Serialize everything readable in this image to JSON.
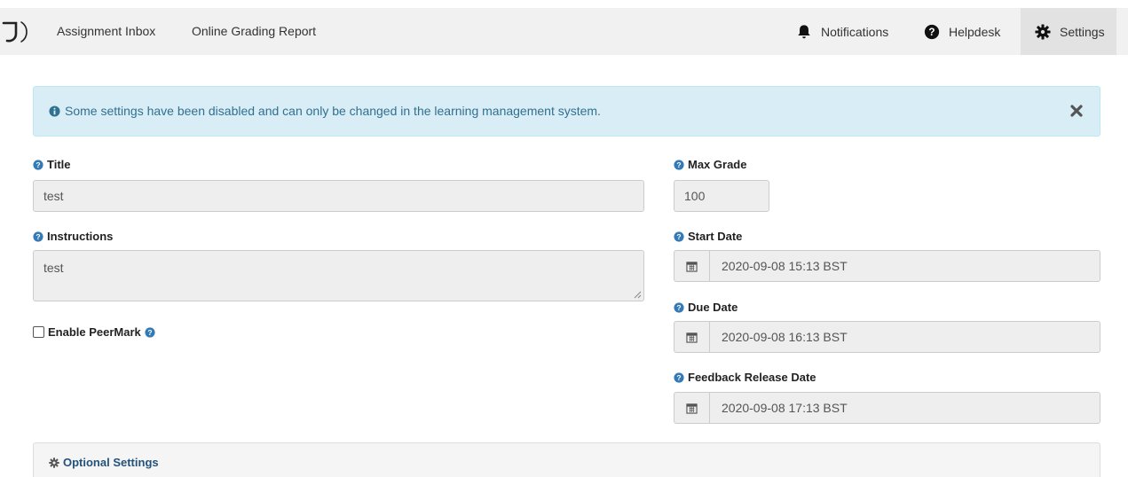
{
  "nav": {
    "logo_icon": "turnitin-logo-icon",
    "links": [
      {
        "label": "Assignment Inbox"
      },
      {
        "label": "Online Grading Report"
      }
    ],
    "right": {
      "notifications": "Notifications",
      "helpdesk": "Helpdesk",
      "settings": "Settings"
    },
    "active": "Settings"
  },
  "alert": {
    "message": "Some settings have been disabled and can only be changed in the learning management system.",
    "icon": "info-circle-icon",
    "close_icon": "close-icon",
    "colors": {
      "background": "#d9edf7",
      "text": "#31708f"
    }
  },
  "form": {
    "title": {
      "label": "Title",
      "value": "test"
    },
    "instructions": {
      "label": "Instructions",
      "value": "test"
    },
    "max_grade": {
      "label": "Max Grade",
      "value": "100"
    },
    "start_date": {
      "label": "Start Date",
      "value": "2020-09-08 15:13 BST"
    },
    "due_date": {
      "label": "Due Date",
      "value": "2020-09-08 16:13 BST"
    },
    "feedback_release_date": {
      "label": "Feedback Release Date",
      "value": "2020-09-08 17:13 BST"
    },
    "peermark": {
      "label": "Enable PeerMark",
      "checked": false
    }
  },
  "optional_settings": {
    "label": "Optional Settings"
  },
  "colors": {
    "help_icon": "#337ab7",
    "link": "#23527c"
  }
}
